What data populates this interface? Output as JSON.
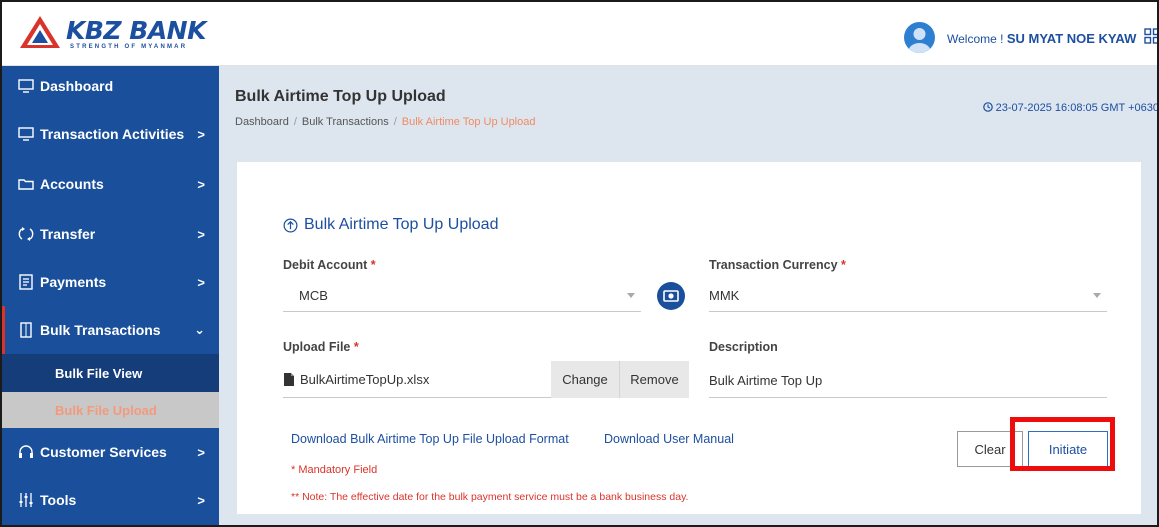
{
  "header": {
    "logo_text": "KBZ BANK",
    "logo_tagline": "STRENGTH OF MYANMAR",
    "welcome_prefix": "Welcome !",
    "user_name": "SU MYAT NOE KYAW"
  },
  "sidebar": {
    "items": [
      {
        "label": "Dashboard",
        "icon": "monitor-icon",
        "chevron": ""
      },
      {
        "label": "Transaction Activities",
        "icon": "monitor-icon",
        "chevron": ">"
      },
      {
        "label": "Accounts",
        "icon": "folder-icon",
        "chevron": ">"
      },
      {
        "label": "Transfer",
        "icon": "transfer-icon",
        "chevron": ">"
      },
      {
        "label": "Payments",
        "icon": "receipt-icon",
        "chevron": ">"
      },
      {
        "label": "Bulk Transactions",
        "icon": "file-icon",
        "chevron": "⌄"
      },
      {
        "label": "Customer Services",
        "icon": "headset-icon",
        "chevron": ">"
      },
      {
        "label": "Tools",
        "icon": "sliders-icon",
        "chevron": ">"
      }
    ],
    "subitems": [
      {
        "label": "Bulk File View"
      },
      {
        "label": "Bulk File Upload"
      }
    ]
  },
  "page": {
    "title": "Bulk Airtime Top Up Upload",
    "breadcrumb": [
      "Dashboard",
      "Bulk Transactions",
      "Bulk Airtime Top Up Upload"
    ],
    "datetime": "23-07-2025 16:08:05 GMT +0630"
  },
  "form": {
    "title": "Bulk Airtime Top Up Upload",
    "debit_account_label": "Debit Account",
    "debit_account_value": "MCB",
    "currency_label": "Transaction Currency",
    "currency_value": "MMK",
    "upload_label": "Upload File",
    "file_name": "BulkAirtimeTopUp.xlsx",
    "change_label": "Change",
    "remove_label": "Remove",
    "description_label": "Description",
    "description_value": "Bulk Airtime Top Up",
    "required_mark": "*",
    "download_format_link": "Download Bulk Airtime Top Up File Upload Format",
    "download_manual_link": "Download User Manual",
    "mandatory_text": "* Mandatory Field",
    "note_text": "** Note: The effective date for the bulk payment service must be a bank business day.",
    "clear_label": "Clear",
    "initiate_label": "Initiate"
  },
  "colors": {
    "brand_blue": "#1a4f9b",
    "accent_red": "#d9342b",
    "highlight_red": "#ee0d0d"
  }
}
